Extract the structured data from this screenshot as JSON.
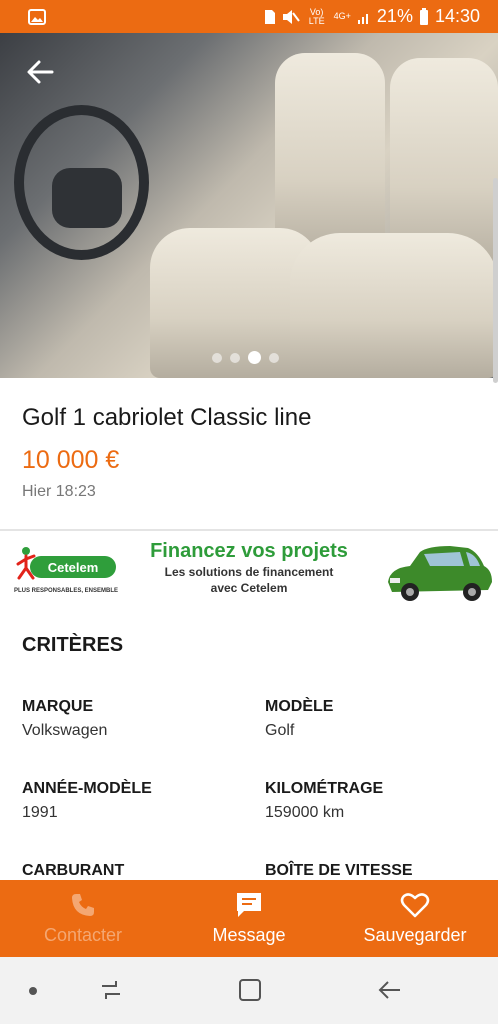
{
  "status_bar": {
    "battery_percent": "21%",
    "time": "14:30",
    "volte_label": "Vo) LTE",
    "network_label": "4G+",
    "icons": [
      "image-icon",
      "sim-icon",
      "mute-icon",
      "signal-icon",
      "battery-icon"
    ]
  },
  "gallery": {
    "image_count": 4,
    "active_index": 2
  },
  "listing": {
    "title": "Golf 1 cabriolet Classic line",
    "price": "10 000 €",
    "date": "Hier 18:23"
  },
  "ad": {
    "brand": "Cetelem",
    "tagline": "PLUS RESPONSABLES, ENSEMBLE",
    "headline": "Financez vos projets",
    "sub_line1": "Les solutions de financement",
    "sub_line2": "avec Cetelem"
  },
  "criteria": {
    "section_title": "CRITÈRES",
    "items": [
      {
        "label": "MARQUE",
        "value": "Volkswagen"
      },
      {
        "label": "MODÈLE",
        "value": "Golf"
      },
      {
        "label": "ANNÉE-MODÈLE",
        "value": "1991"
      },
      {
        "label": "KILOMÉTRAGE",
        "value": "159000 km"
      },
      {
        "label": "CARBURANT",
        "value": ""
      },
      {
        "label": "BOÎTE DE VITESSE",
        "value": ""
      }
    ]
  },
  "actions": {
    "contact": "Contacter",
    "message": "Message",
    "save": "Sauvegarder"
  },
  "colors": {
    "brand_orange": "#ec6b12",
    "ad_green": "#2e9c3a"
  }
}
